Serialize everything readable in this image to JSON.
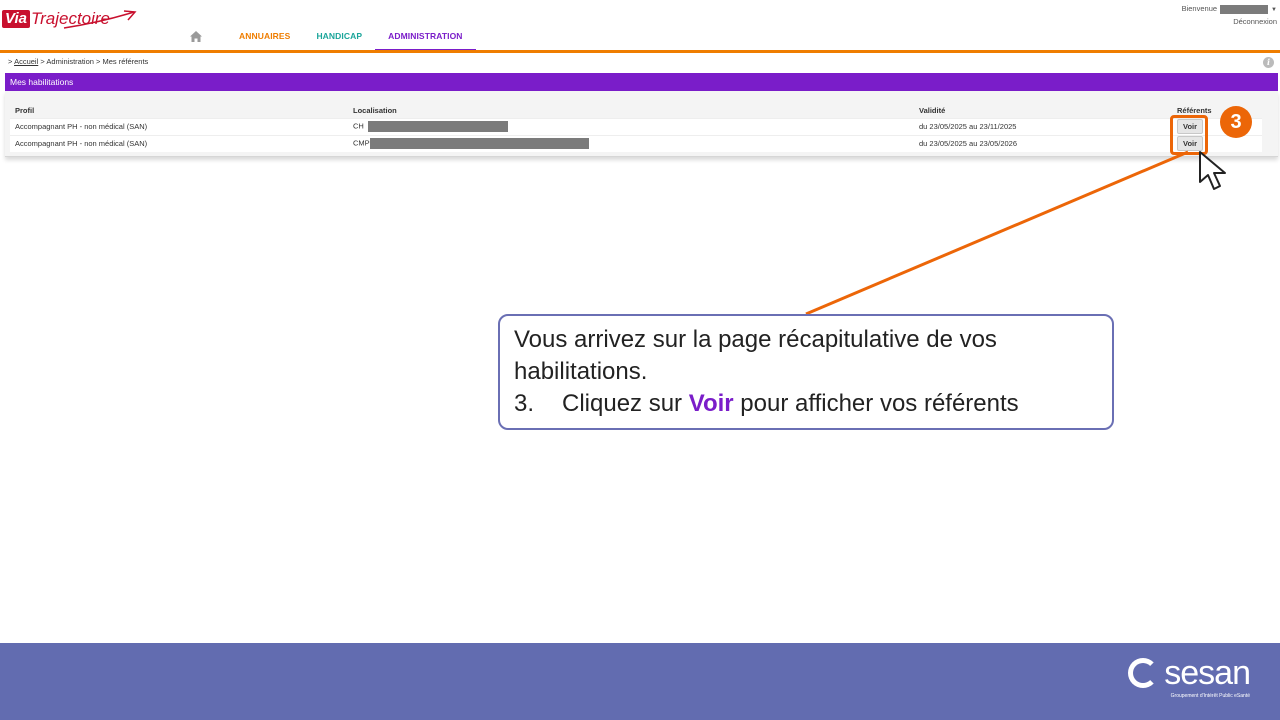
{
  "header": {
    "logo": {
      "part1": "Via",
      "part2": "Trajectoire"
    },
    "nav": {
      "home_icon": "home-icon",
      "items": [
        "ANNUAIRES",
        "HANDICAP",
        "ADMINISTRATION"
      ],
      "active": "ADMINISTRATION"
    },
    "user": {
      "greeting": "Bienvenue",
      "logout": "Déconnexion"
    }
  },
  "breadcrumb": {
    "prefix": ">",
    "home": "Accueil",
    "rest": "> Administration > Mes référents"
  },
  "section": {
    "title": "Mes habilitations"
  },
  "table": {
    "headers": [
      "Profil",
      "Localisation",
      "Validité",
      "Référents"
    ],
    "rows": [
      {
        "profil": "Accompagnant PH - non médical (SAN)",
        "localisation": "CH",
        "validite": "du 23/05/2025 au 23/11/2025",
        "action": "Voir"
      },
      {
        "profil": "Accompagnant PH - non médical (SAN)",
        "localisation": "CMP",
        "validite": "du 23/05/2025 au 23/05/2026",
        "action": "Voir"
      }
    ]
  },
  "annotation": {
    "step": "3",
    "line1": "Vous arrivez sur la page récapitulative de vos habilitations.",
    "step_num": "3.",
    "step_text_before": "Cliquez sur",
    "step_highlight": "Voir",
    "step_text_after": "pour afficher vos référents"
  },
  "footer": {
    "brand": "sesan",
    "tagline": "Groupement d'Intérêt Public eSanté"
  },
  "colors": {
    "orange": "#ef7d00",
    "purple": "#7a1dc9",
    "teal": "#1aa59a",
    "footer": "#626cb0",
    "callout_border": "#6a6fb4"
  }
}
